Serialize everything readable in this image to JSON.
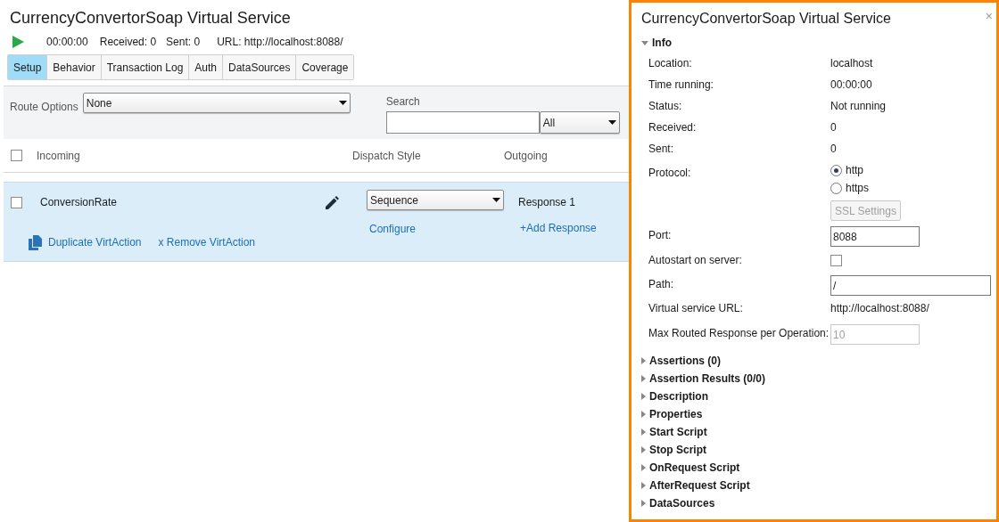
{
  "header": {
    "title": "CurrencyConvertorSoap Virtual Service",
    "running": false,
    "time": "00:00:00",
    "received": "Received: 0",
    "sent": "Sent: 0",
    "url": "URL: http://localhost:8088/"
  },
  "tabs": [
    {
      "label": "Setup",
      "selected": true
    },
    {
      "label": "Behavior",
      "selected": false
    },
    {
      "label": "Transaction Log",
      "selected": false
    },
    {
      "label": "Auth",
      "selected": false
    },
    {
      "label": "DataSources",
      "selected": false
    },
    {
      "label": "Coverage",
      "selected": false
    }
  ],
  "toolbar": {
    "route_label": "Route Options",
    "route_value": "None",
    "search_label": "Search",
    "search_filter": "All"
  },
  "table": {
    "all_checked": false,
    "columns": [
      "Incoming",
      "Dispatch Style",
      "Outgoing"
    ],
    "rows": [
      {
        "checked": false,
        "selected": true,
        "name": "ConversionRate",
        "dispatch": "Sequence",
        "configure": "Configure",
        "response": "Response 1",
        "add_response": "+Add Response",
        "duplicate": "Duplicate VirtAction",
        "remove": "x Remove VirtAction"
      }
    ]
  },
  "panel": {
    "title": "CurrencyConvertorSoap Virtual Service",
    "close": "×",
    "info": {
      "label": "Info",
      "expanded": true,
      "rows": [
        {
          "kind": "text",
          "label": "Location:",
          "value": "localhost"
        },
        {
          "kind": "text",
          "label": "Time running:",
          "value": "00:00:00"
        },
        {
          "kind": "text",
          "label": "Status:",
          "value": "Not running"
        },
        {
          "kind": "text",
          "label": "Received:",
          "value": "0"
        },
        {
          "kind": "text",
          "label": "Sent:",
          "value": "0"
        },
        {
          "kind": "radio",
          "label": "Protocol:",
          "options": [
            {
              "label": "http",
              "selected": true
            },
            {
              "label": "https",
              "selected": false
            }
          ],
          "button": "SSL Settings",
          "button_disabled": true
        },
        {
          "kind": "input",
          "label": "Port:",
          "value": "8088",
          "wide": false,
          "disabled": false
        },
        {
          "kind": "checkbox",
          "label": "Autostart on server:",
          "checked": false
        },
        {
          "kind": "input",
          "label": "Path:",
          "value": "/",
          "wide": true,
          "disabled": false
        },
        {
          "kind": "text",
          "label": "Virtual service URL:",
          "value": "http://localhost:8088/"
        },
        {
          "kind": "input",
          "label": "Max Routed Response per Operation:",
          "value": "10",
          "wide": false,
          "disabled": true
        }
      ]
    },
    "sections": [
      {
        "label": "Assertions (0)",
        "expanded": false
      },
      {
        "label": "Assertion Results (0/0)",
        "expanded": false
      },
      {
        "label": "Description",
        "expanded": false
      },
      {
        "label": "Properties",
        "expanded": false
      },
      {
        "label": "Start Script",
        "expanded": false
      },
      {
        "label": "Stop Script",
        "expanded": false
      },
      {
        "label": "OnRequest Script",
        "expanded": false
      },
      {
        "label": "AfterRequest Script",
        "expanded": false
      },
      {
        "label": "DataSources",
        "expanded": false
      }
    ]
  }
}
